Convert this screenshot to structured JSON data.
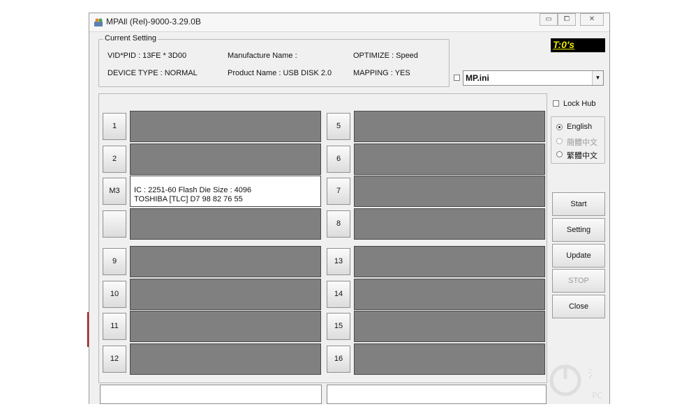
{
  "window": {
    "title": "MPAll (Rel)-9000-3.29.0B",
    "timer": "T:0's"
  },
  "current_setting": {
    "legend": "Current Setting",
    "vid_pid": "VID*PID : 13FE * 3D00",
    "device_type": "DEVICE TYPE : NORMAL",
    "manufacture_name": "Manufacture Name :",
    "product_name": "Product Name : USB DISK 2.0",
    "optimize": "OPTIMIZE : Speed",
    "mapping": "MAPPING : YES"
  },
  "config_file": {
    "value": "MP.ini",
    "checked": false
  },
  "lock_hub": {
    "label": "Lock Hub",
    "checked": false
  },
  "languages": [
    {
      "label": "English",
      "selected": true,
      "enabled": true
    },
    {
      "label": "簡體中文",
      "selected": false,
      "enabled": false
    },
    {
      "label": "繁體中文",
      "selected": false,
      "enabled": true
    }
  ],
  "ports_left": [
    {
      "label": "1",
      "line1": "",
      "line2": "",
      "active": false
    },
    {
      "label": "2",
      "line1": "",
      "line2": "",
      "active": false
    },
    {
      "label": "M3",
      "line1": "IC : 2251-60  Flash Die Size : 4096",
      "line2": "TOSHIBA [TLC] D7 98 82 76 55",
      "active": true
    },
    {
      "label": "",
      "line1": "",
      "line2": "",
      "active": false
    },
    {
      "label": "9",
      "line1": "",
      "line2": "",
      "active": false
    },
    {
      "label": "10",
      "line1": "",
      "line2": "",
      "active": false
    },
    {
      "label": "11",
      "line1": "",
      "line2": "",
      "active": false
    },
    {
      "label": "12",
      "line1": "",
      "line2": "",
      "active": false
    }
  ],
  "ports_right": [
    {
      "label": "5"
    },
    {
      "label": "6"
    },
    {
      "label": "7"
    },
    {
      "label": "8"
    },
    {
      "label": "13"
    },
    {
      "label": "14"
    },
    {
      "label": "15"
    },
    {
      "label": "16"
    }
  ],
  "buttons": {
    "start": "Start",
    "setting": "Setting",
    "update": "Update",
    "stop": "STOP",
    "close": "Close"
  },
  "colors": {
    "slot_idle": "#808080",
    "slot_active": "#ffffff",
    "timer_bg": "#000000",
    "timer_text": "#e8e800"
  }
}
